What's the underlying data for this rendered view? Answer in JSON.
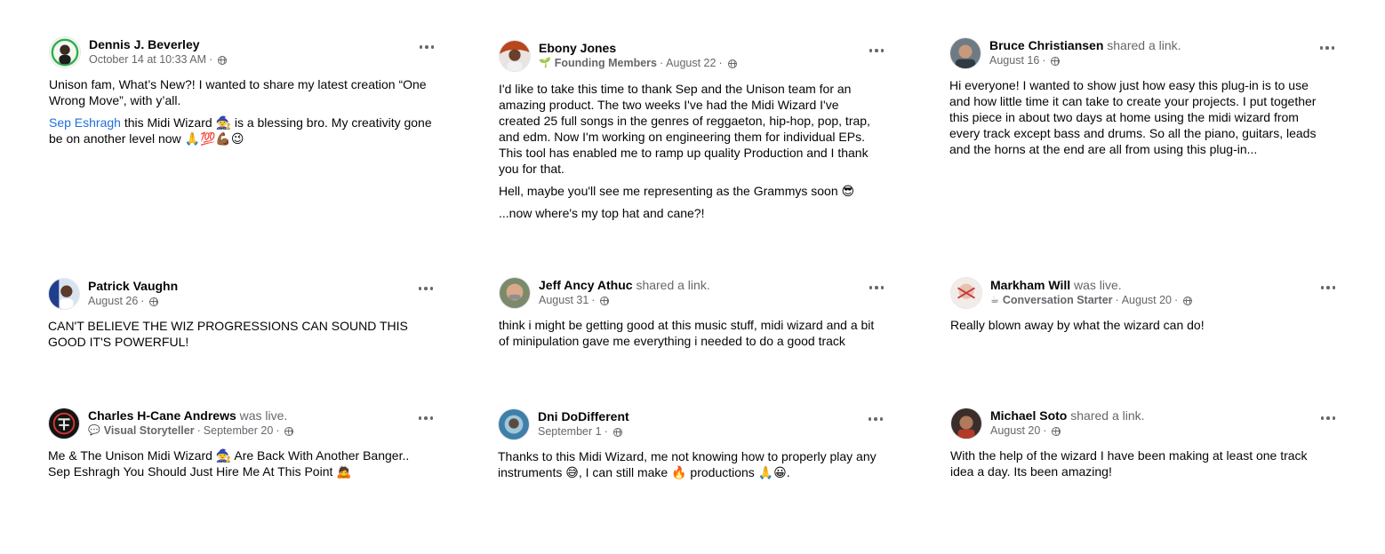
{
  "posts": [
    {
      "author": "Dennis J. Beverley",
      "action": "",
      "badge": "",
      "date": "October 14 at 10:33 AM",
      "paragraphs": [
        "Unison fam, What’s New?! I wanted to share my latest creation “One Wrong Move”, with y’all."
      ],
      "mention": "Sep Eshragh",
      "mention_rest": " this Midi Wizard 🧙 is a blessing bro. My creativity gone be on another level now 🙏💯💪🏾😉"
    },
    {
      "author": "Ebony Jones",
      "action": "",
      "badge": "Founding Members",
      "badge_icon": "seedling-icon",
      "date": "August 22",
      "paragraphs": [
        "I'd like to take this time to thank Sep and the Unison team for an amazing product. The two weeks I've had the Midi Wizard I've created 25 full songs in the genres of reggaeton, hip-hop, pop, trap, and edm. Now I'm working on engineering them for individual EPs. This tool has enabled me to ramp up quality Production and I thank you for that.",
        "Hell, maybe you'll see me representing as the Grammys soon 😎",
        "...now where's my top hat and cane?!"
      ]
    },
    {
      "author": "Bruce Christiansen",
      "action": "shared a link.",
      "badge": "",
      "date": "August 16",
      "paragraphs": [
        "Hi everyone!  I wanted to show just how easy this plug-in is to use and how little time it can take to create your projects. I put together this piece in about two days at home using the midi wizard from every track except bass and drums. So all the piano, guitars, leads and the horns at the end are all from using this plug-in..."
      ]
    },
    {
      "author": "Patrick Vaughn",
      "action": "",
      "badge": "",
      "date": "August 26",
      "paragraphs": [
        "CAN'T BELIEVE THE WIZ PROGRESSIONS CAN SOUND THIS GOOD IT'S POWERFUL!"
      ]
    },
    {
      "author": "Jeff Ancy Athuc",
      "action": "shared a link.",
      "badge": "",
      "date": "August 31",
      "paragraphs": [
        "think i might be getting good at this music stuff, midi wizard and a bit of minipulation gave me everything i needed to do a good track"
      ]
    },
    {
      "author": "Markham Will",
      "action": "was live.",
      "badge": "Conversation Starter",
      "badge_icon": "coffee-icon",
      "date": "August 20",
      "paragraphs": [
        "Really blown away by what the wizard can do!"
      ]
    },
    {
      "author": "Charles H-Cane Andrews",
      "action": "was live.",
      "badge": "Visual Storyteller",
      "badge_icon": "speech-bubble-icon",
      "date": "September 20",
      "paragraphs": [
        "Me & The Unison Midi Wizard 🧙 Are Back With Another Banger.. Sep Eshragh You Should Just Hire Me At This Point 🙇"
      ]
    },
    {
      "author": "Dni DoDifferent",
      "action": "",
      "badge": "",
      "date": "September 1",
      "paragraphs": [
        "Thanks to this Midi Wizard, me not knowing how to properly play any instruments 😅, I can still make 🔥 productions 🙏😀."
      ]
    },
    {
      "author": "Michael Soto",
      "action": "shared a link.",
      "badge": "",
      "date": "August 20",
      "paragraphs": [
        "With the help of the wizard I have been making at least one track idea a day. Its been amazing!"
      ]
    }
  ],
  "badge_icons": {
    "seedling-icon": "🌱",
    "coffee-icon": "☕",
    "speech-bubble-icon": "💬"
  },
  "colors": {
    "name": "#050505",
    "secondary": "#65676b",
    "mention": "#216fdb"
  }
}
